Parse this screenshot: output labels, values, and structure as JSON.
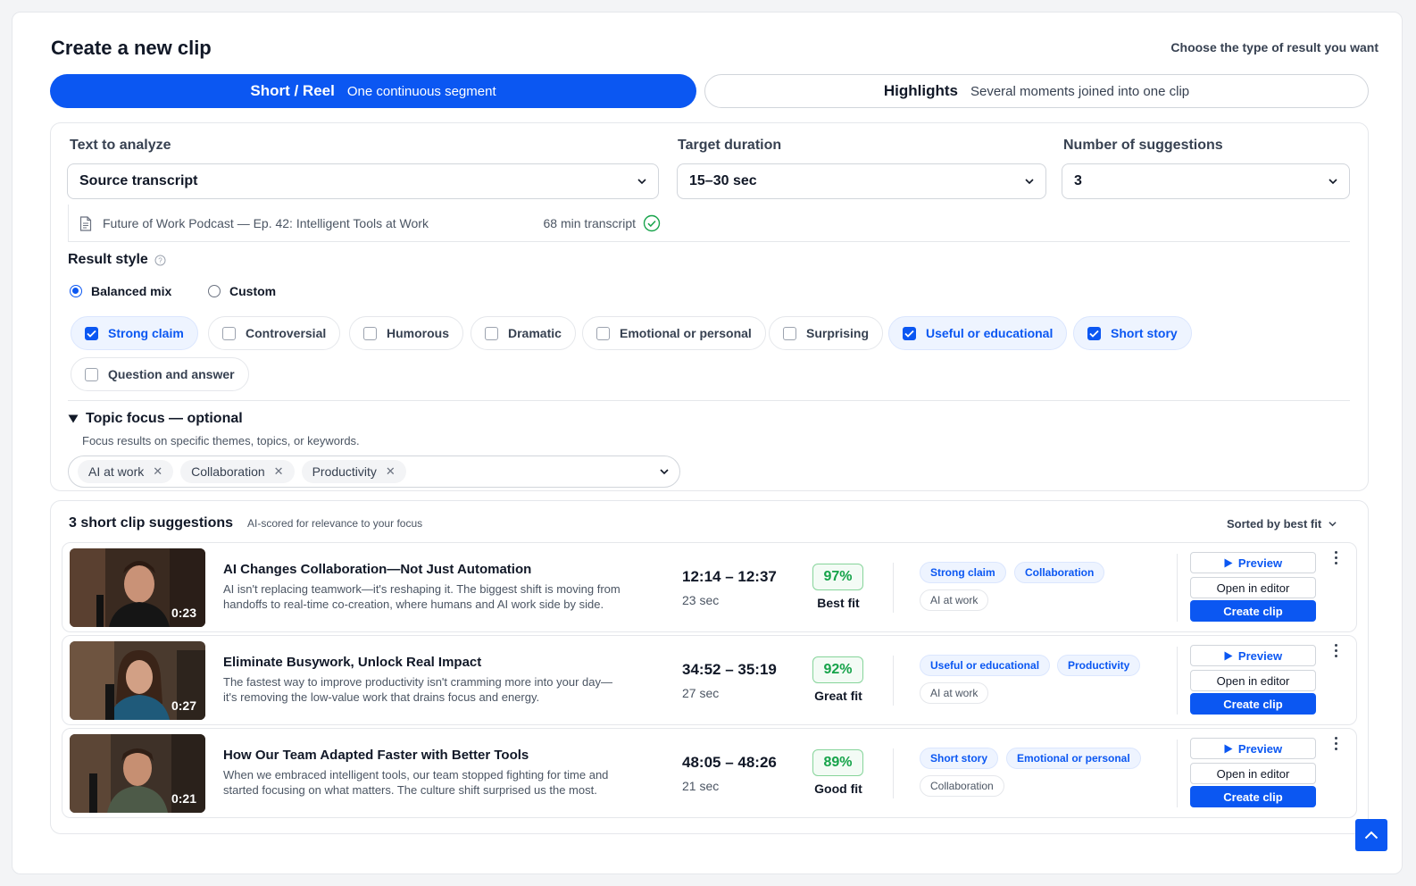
{
  "page": {
    "title": "Create a new clip",
    "hint": "Choose the type of result you want"
  },
  "modes": [
    {
      "title": "Short / Reel",
      "subtitle": "One continuous segment",
      "active": true
    },
    {
      "title": "Highlights",
      "subtitle": "Several moments joined into one clip",
      "active": false
    }
  ],
  "form": {
    "text_label": "Text to analyze",
    "text_value": "Source transcript",
    "source_name": "Future of Work Podcast — Ep. 42: Intelligent Tools at Work",
    "source_length": "68 min transcript",
    "duration_label": "Target duration",
    "duration_value": "15–30 sec",
    "count_label": "Number of suggestions",
    "count_value": "3"
  },
  "style": {
    "label": "Result style",
    "radios": [
      {
        "label": "Balanced mix",
        "checked": true
      },
      {
        "label": "Custom",
        "checked": false
      }
    ],
    "chips": [
      {
        "label": "Strong claim",
        "checked": true
      },
      {
        "label": "Controversial",
        "checked": false
      },
      {
        "label": "Humorous",
        "checked": false
      },
      {
        "label": "Dramatic",
        "checked": false
      },
      {
        "label": "Emotional or personal",
        "checked": false
      },
      {
        "label": "Surprising",
        "checked": false
      },
      {
        "label": "Useful or educational",
        "checked": true
      },
      {
        "label": "Short story",
        "checked": true
      },
      {
        "label": "Question and answer",
        "checked": false
      }
    ]
  },
  "topic": {
    "title": "Topic focus — optional",
    "description": "Focus results on specific themes, topics, or keywords.",
    "tags": [
      "AI at work",
      "Collaboration",
      "Productivity"
    ]
  },
  "results": {
    "heading": "3 short clip suggestions",
    "subheading": "AI-scored for relevance to your focus",
    "sort_label": "Sorted by best fit",
    "preview_label": "Preview",
    "editor_label": "Open in editor",
    "create_label": "Create clip",
    "items": [
      {
        "duration": "0:23",
        "title": "AI Changes Collaboration—Not Just Automation",
        "desc_line1": "AI isn't replacing teamwork—it's reshaping it. The biggest shift is moving from",
        "desc_line2": "handoffs to real-time co-creation, where humans and AI work side by side.",
        "range": "12:14 – 12:37",
        "length": "23 sec",
        "score": "97%",
        "fit": "Best fit",
        "tags": [
          "Strong claim",
          "Collaboration",
          "AI at work"
        ]
      },
      {
        "duration": "0:27",
        "title": "Eliminate Busywork, Unlock Real Impact",
        "desc_line1": "The fastest way to improve productivity isn't cramming more into your day—",
        "desc_line2": "it's removing the low-value work that drains focus and energy.",
        "range": "34:52 – 35:19",
        "length": "27 sec",
        "score": "92%",
        "fit": "Great fit",
        "tags": [
          "Useful or educational",
          "Productivity",
          "AI at work"
        ]
      },
      {
        "duration": "0:21",
        "title": "How Our Team Adapted Faster with Better Tools",
        "desc_line1": "When we embraced intelligent tools, our team stopped fighting for time and",
        "desc_line2": "started focusing on what matters. The culture shift surprised us the most.",
        "range": "48:05 – 48:26",
        "length": "21 sec",
        "score": "89%",
        "fit": "Good fit",
        "tags": [
          "Short story",
          "Emotional or personal",
          "Collaboration"
        ]
      }
    ]
  },
  "colors": {
    "accent": "#0b57f2",
    "success": "#16a34a",
    "border": "#e5e7eb"
  }
}
